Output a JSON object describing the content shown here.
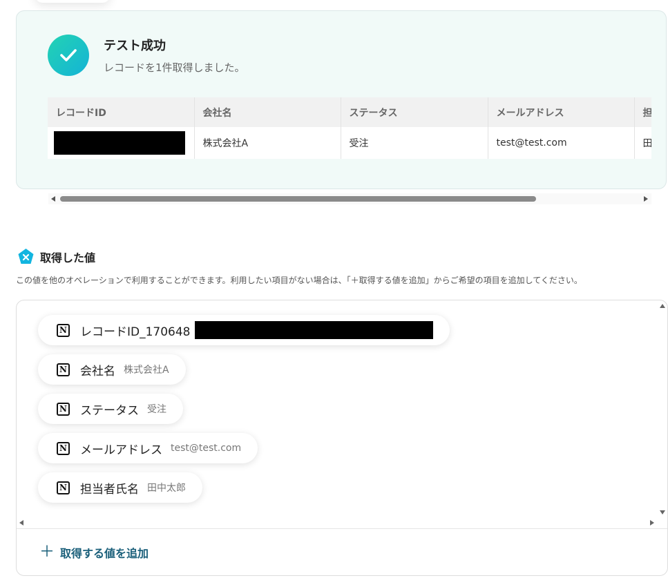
{
  "test_result": {
    "title": "テスト成功",
    "subtitle": "レコードを1件取得しました。",
    "columns": [
      "レコードID",
      "会社名",
      "ステータス",
      "メールアドレス",
      "担"
    ],
    "rows": [
      {
        "record_id": "",
        "company": "株式会社A",
        "status": "受注",
        "email": "test@test.com",
        "partial": "田"
      }
    ]
  },
  "section": {
    "title": "取得した値",
    "description": "この値を他のオペレーションで利用することができます。利用したい項目がない場合は、「＋取得する値を追加」からご希望の項目を追加してください。"
  },
  "values": [
    {
      "name": "レコードID_170648",
      "value": ""
    },
    {
      "name": "会社名",
      "value": "株式会社A"
    },
    {
      "name": "ステータス",
      "value": "受注"
    },
    {
      "name": "メールアドレス",
      "value": "test@test.com"
    },
    {
      "name": "担当者氏名",
      "value": "田中太郎"
    }
  ],
  "add_value_label": "取得する値を追加",
  "icons": {
    "success": "check-circle-icon",
    "section": "yoom-logo-icon",
    "value": "notion-icon",
    "add": "plus-icon"
  },
  "colors": {
    "accent": "#1a5f7a",
    "success_gradient_start": "#23d3b3",
    "success_gradient_end": "#14b3d6",
    "result_background": "#f1faf8"
  }
}
